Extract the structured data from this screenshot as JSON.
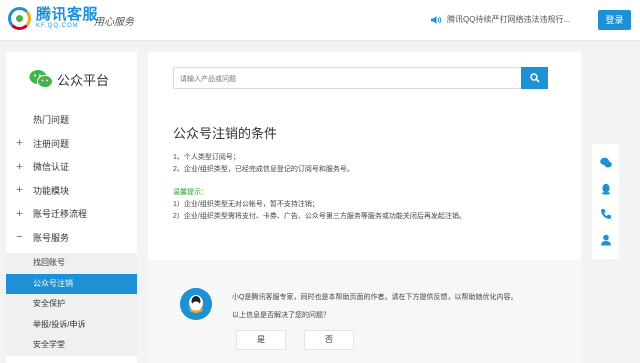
{
  "header": {
    "logo_title": "腾讯客服",
    "logo_sub": "KF.QQ.COM",
    "slogan": "用心服务",
    "notice": "腾讯QQ持续严打网络违法违规行...",
    "login_label": "登录"
  },
  "sidebar": {
    "brand": "公众平台",
    "items": [
      {
        "sign": "",
        "label": "热门问题"
      },
      {
        "sign": "+",
        "label": "注册问题"
      },
      {
        "sign": "+",
        "label": "微信认证"
      },
      {
        "sign": "+",
        "label": "功能模块"
      },
      {
        "sign": "+",
        "label": "账号迁移流程"
      },
      {
        "sign": "−",
        "label": "账号服务"
      }
    ],
    "subitems": [
      "找回账号",
      "公众号注销",
      "安全保护",
      "举报/投诉/申诉",
      "安全学堂"
    ]
  },
  "main": {
    "search_placeholder": "请输入产品或问题",
    "title": "公众号注销的条件",
    "lines": [
      "1、个人类型订阅号；",
      "2、企业/组织类型，已经完成信息登记的订阅号和服务号。"
    ],
    "tip_title": "温馨提示：",
    "tips": [
      "1）企业/组织类型无对公帐号，暂不支持注销；",
      "2）企业/组织类型需将支付、卡券、广告、公众号第三方服务等服务或功能关闭后再发起注销。"
    ],
    "feedback": {
      "text1": "小Q是腾讯客服专家，同时也是本帮助页面的作者。请在下方提供反馈，以帮助她优化内容。",
      "text2": "以上信息是否解决了您的问题？",
      "yes": "是",
      "no": "否"
    }
  },
  "colors": {
    "accent": "#1e90d6",
    "tip_green": "#2e9e2e"
  },
  "icons": [
    "speaker-icon",
    "search-icon",
    "wechat-icon",
    "qq-icon",
    "phone-icon",
    "user-icon"
  ]
}
